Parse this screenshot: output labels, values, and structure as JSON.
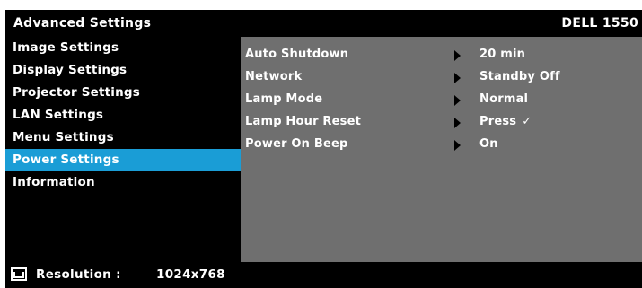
{
  "header": {
    "title": "Advanced Settings",
    "model": "DELL 1550"
  },
  "sidebar": {
    "items": [
      {
        "label": "Image Settings"
      },
      {
        "label": "Display Settings"
      },
      {
        "label": "Projector Settings"
      },
      {
        "label": "LAN Settings"
      },
      {
        "label": "Menu Settings"
      },
      {
        "label": "Power Settings",
        "selected": true
      },
      {
        "label": "Information"
      }
    ]
  },
  "panel": {
    "rows": [
      {
        "label": "Auto Shutdown",
        "value": "20  min"
      },
      {
        "label": "Network",
        "value": "Standby Off"
      },
      {
        "label": "Lamp Mode",
        "value": "Normal"
      },
      {
        "label": "Lamp Hour Reset",
        "value": "Press",
        "check": "✓"
      },
      {
        "label": "Power On Beep",
        "value": "On"
      }
    ]
  },
  "footer": {
    "resolution_label": "Resolution :",
    "resolution_value": "1024x768"
  },
  "colors": {
    "background": "#000000",
    "panel": "#6f6f6f",
    "selected": "#1a9dd6",
    "text": "#ffffff"
  },
  "icons": {
    "arrow": "triangle-right-icon",
    "resolution": "screen-resolution-icon"
  }
}
